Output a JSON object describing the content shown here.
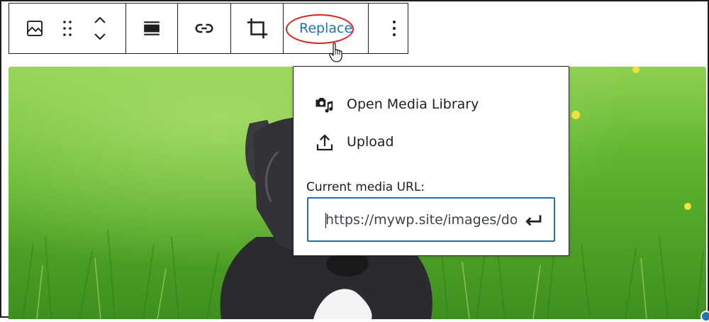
{
  "toolbar": {
    "buttons": [
      {
        "icon": "image-icon"
      },
      {
        "icon": "drag-handle-icon"
      },
      {
        "icon": "move-up-down-icon"
      },
      {
        "icon": "align-icon"
      },
      {
        "icon": "link-icon"
      },
      {
        "icon": "crop-icon"
      },
      {
        "label": "Replace"
      },
      {
        "icon": "more-options-icon"
      }
    ],
    "replace_label": "Replace"
  },
  "popover": {
    "items": [
      {
        "icon": "camera-music-icon",
        "label": "Open Media Library"
      },
      {
        "icon": "upload-icon",
        "label": "Upload"
      }
    ],
    "url_label": "Current media URL:",
    "url_value": "https://mywp.site/images/dog"
  },
  "colors": {
    "accent": "#2271b1",
    "highlight_ring": "#e0201a",
    "text": "#1e1e1e"
  }
}
